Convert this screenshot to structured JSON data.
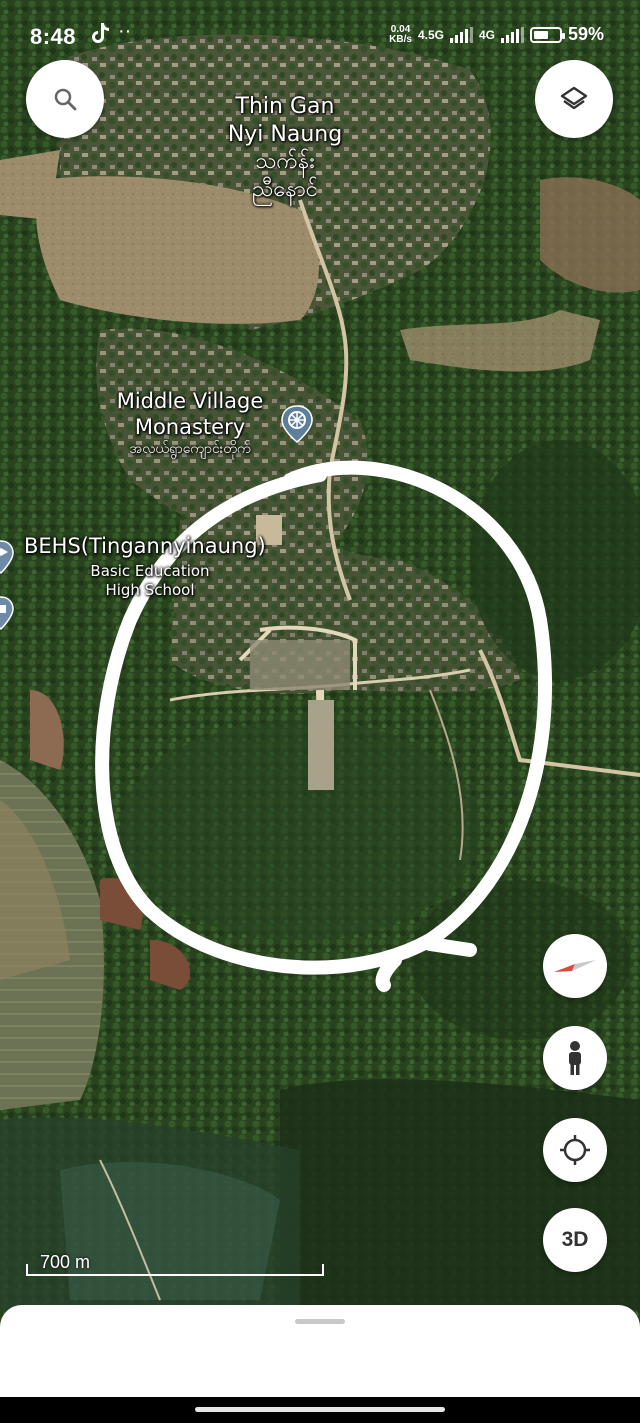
{
  "status_bar": {
    "time": "8:48",
    "app_icon": "tiktok-icon",
    "more": "··",
    "speed_value": "0.04",
    "speed_unit": "KB/s",
    "network_1": "4.5G",
    "network_2": "4G",
    "battery_percent": "59%",
    "battery_level": 0.59
  },
  "controls": {
    "search_icon": "search-icon",
    "layers_icon": "layers-icon",
    "compass_icon": "compass-icon",
    "street_view_icon": "pegman-icon",
    "my_location_icon": "crosshair-icon",
    "three_d_label": "3D"
  },
  "places": {
    "town": {
      "name_en_1": "Thin Gan",
      "name_en_2": "Nyi Naung",
      "name_my_1": "သက်န်း",
      "name_my_2": "ညီနောင်"
    },
    "monastery": {
      "name_en_1": "Middle Village",
      "name_en_2": "Monastery",
      "name_my": "အလယ်ရွာကျောင်းတိုက်",
      "icon": "dharma-wheel-icon"
    },
    "school": {
      "name": "BEHS(Tingannyinaung)",
      "sub_1": "Basic Education",
      "sub_2": "High School",
      "icon": "school-icon"
    }
  },
  "scale_bar": {
    "label": "700 m"
  },
  "annotation": {
    "shape": "hand-drawn white circle",
    "color": "#ffffff"
  },
  "colors": {
    "forest": "#2f4a24",
    "field": "#9a8a68",
    "road": "#d9cdb0",
    "water_blue": "#4b8fd6"
  }
}
